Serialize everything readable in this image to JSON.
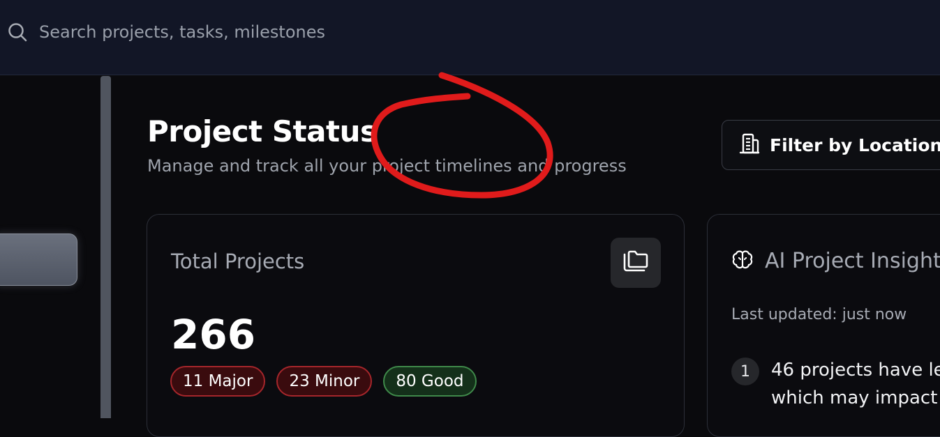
{
  "topbar": {
    "search": {
      "placeholder": "Search projects, tasks, milestones"
    }
  },
  "header": {
    "title": "Project Status",
    "subtitle": "Manage and track all your project timelines and progress",
    "filter_button_label": "Filter by Location"
  },
  "total_projects_card": {
    "title": "Total Projects",
    "count": "266",
    "badges": [
      {
        "label": "11 Major",
        "kind": "major"
      },
      {
        "label": "23 Minor",
        "kind": "minor"
      },
      {
        "label": "80 Good",
        "kind": "good"
      }
    ],
    "icon": "folders-icon"
  },
  "ai_insights_card": {
    "title": "AI Project Insights",
    "icon": "brain-icon",
    "last_updated": "Last updated: just now",
    "insights": [
      {
        "number": "1",
        "text_line1": "46 projects have le",
        "text_line2": "which may impact"
      }
    ]
  },
  "colors": {
    "topbar_bg": "#121626",
    "page_bg": "#0a0a0d",
    "badge_major_border": "#a6262b",
    "badge_good_border": "#3f8a4a",
    "annotation_red": "#e01b1b"
  }
}
